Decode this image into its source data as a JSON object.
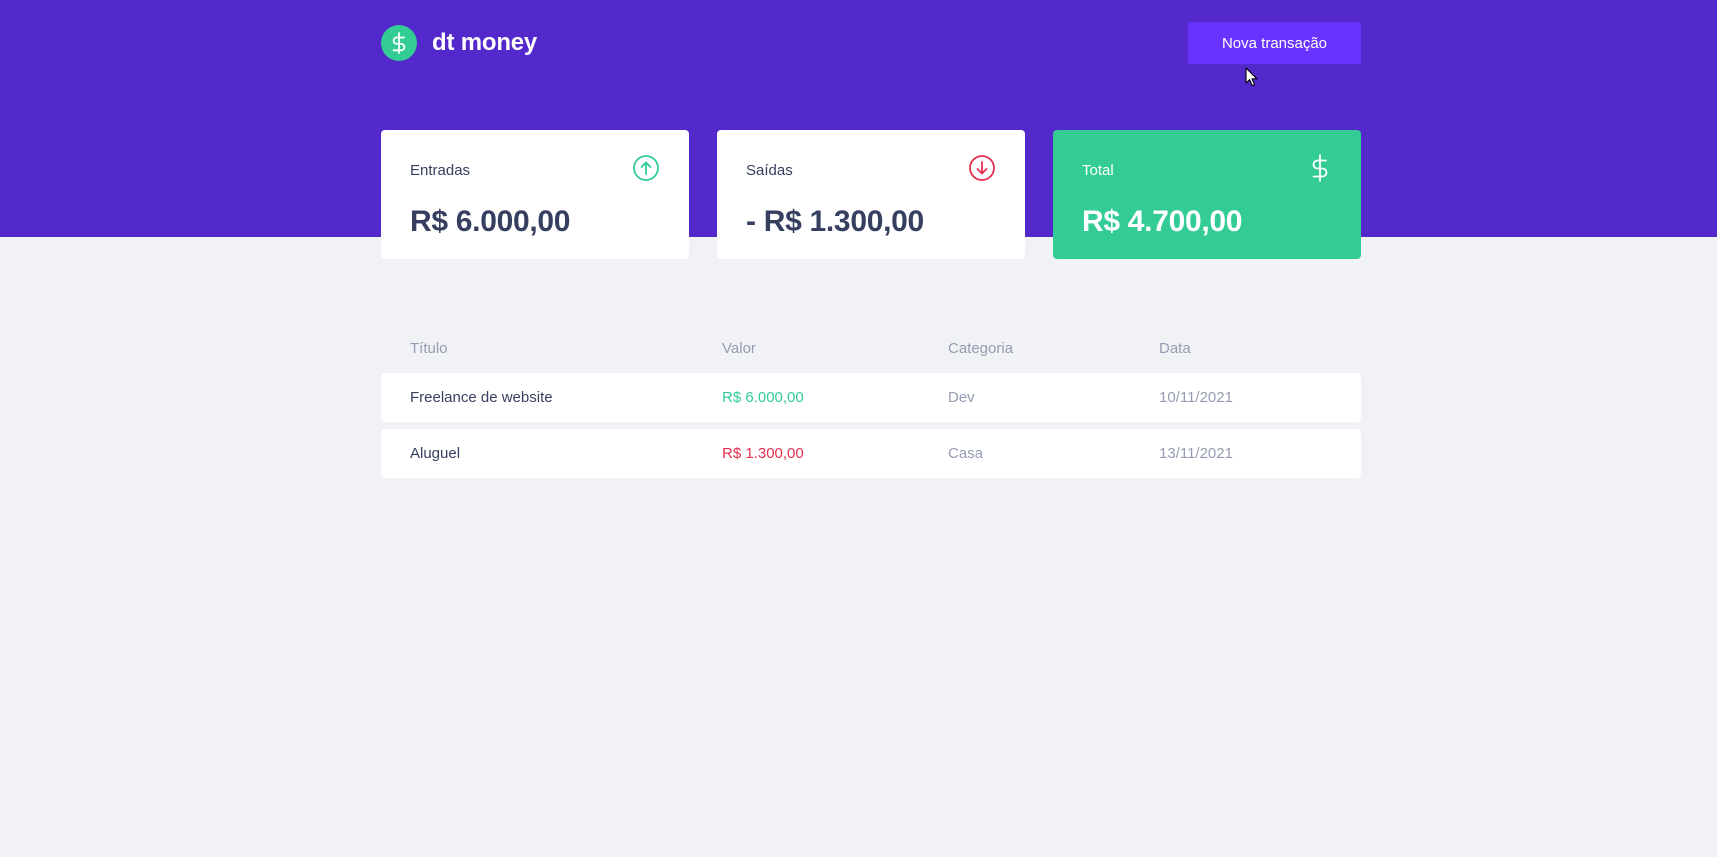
{
  "app": {
    "name": "dt money",
    "new_button_label": "Nova transação"
  },
  "summary": {
    "income": {
      "label": "Entradas",
      "value": "R$ 6.000,00",
      "icon": "arrow-up-circle-icon"
    },
    "outcome": {
      "label": "Saídas",
      "value": "- R$ 1.300,00",
      "icon": "arrow-down-circle-icon"
    },
    "total": {
      "label": "Total",
      "value": "R$ 4.700,00",
      "icon": "dollar-sign-icon"
    }
  },
  "table": {
    "headers": [
      "Título",
      "Valor",
      "Categoria",
      "Data"
    ],
    "rows": [
      {
        "title": "Freelance de website",
        "amount": "R$ 6.000,00",
        "type": "deposit",
        "category": "Dev",
        "date": "10/11/2021"
      },
      {
        "title": "Aluguel",
        "amount": "R$ 1.300,00",
        "type": "withdraw",
        "category": "Casa",
        "date": "13/11/2021"
      }
    ]
  },
  "colors": {
    "header_bg": "#5429cc",
    "button_bg": "#6933ff",
    "green": "#33cc95",
    "red": "#e52e4d",
    "page_bg": "#f0f2f5",
    "text_title": "#363f5f",
    "text_body": "#969cb3"
  }
}
